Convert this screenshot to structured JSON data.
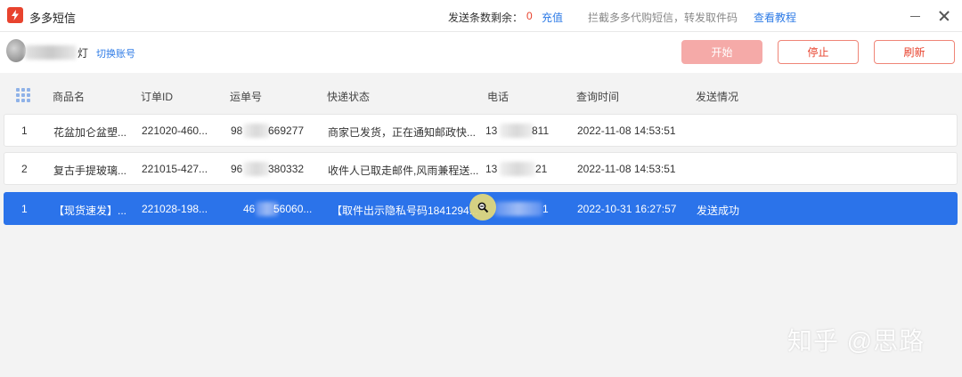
{
  "app": {
    "title": "多多短信",
    "quota_label": "发送条数剩余：",
    "quota_value": "0",
    "recharge_label": "充值",
    "promo_text": "拦截多多代购短信，转发取件码",
    "tutorial_label": "查看教程"
  },
  "account": {
    "name_suffix": "灯",
    "switch_label": "切换账号"
  },
  "toolbar": {
    "start_label": "开始",
    "stop_label": "停止",
    "refresh_label": "刷新"
  },
  "table": {
    "columns": [
      "商品名",
      "订单ID",
      "运单号",
      "快递状态",
      "电话",
      "查询时间",
      "发送情况"
    ],
    "rows": [
      {
        "index": "1",
        "product": "花盆加仑盆塑...",
        "order_id": "221020-460...",
        "tracking_prefix": "98",
        "tracking_suffix": "669277",
        "status": "商家已发货，正在通知邮政快...",
        "phone_prefix": "13",
        "phone_suffix": "811",
        "time": "2022-11-08 14:53:51",
        "send_status": ""
      },
      {
        "index": "2",
        "product": "复古手提玻璃...",
        "order_id": "221015-427...",
        "tracking_prefix": "96",
        "tracking_suffix": "380332",
        "status": "收件人已取走邮件,风雨兼程送...",
        "phone_prefix": "13",
        "phone_suffix": "21",
        "time": "2022-11-08 14:53:51",
        "send_status": ""
      },
      {
        "index": "1",
        "product": "【现货速发】...",
        "order_id": "221028-198...",
        "tracking_prefix": "46",
        "tracking_suffix": "56060...",
        "status": "【取件出示隐私号码1841294...",
        "phone_prefix": "",
        "phone_suffix": "1",
        "time": "2022-10-31 16:27:57",
        "send_status": "发送成功"
      }
    ]
  },
  "watermark": "知乎 @思路",
  "colors": {
    "accent_red": "#e8432e",
    "link_blue": "#2e7be6",
    "selected_row": "#2b73ea"
  }
}
